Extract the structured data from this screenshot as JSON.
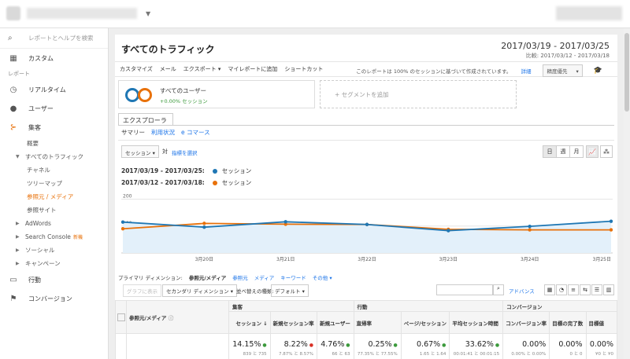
{
  "sidebar": {
    "search_placeholder": "レポートとヘルプを検索",
    "custom": "カスタム",
    "reports_label": "レポート",
    "realtime": "リアルタイム",
    "audience": "ユーザー",
    "acquisition": "集客",
    "overview": "概要",
    "all_traffic": "すべてのトラフィック",
    "channels": "チャネル",
    "treemap": "ツリーマップ",
    "source_medium": "参照元 / メディア",
    "referrals": "参照サイト",
    "adwords": "AdWords",
    "search_console": "Search Console",
    "new_badge": "新機",
    "social": "ソーシャル",
    "campaigns": "キャンペーン",
    "behavior": "行動",
    "conversions": "コンバージョン"
  },
  "header": {
    "title": "すべてのトラフィック",
    "date_range": "2017/03/19 - 2017/03/25",
    "compare_range": "比較: 2017/03/12 - 2017/03/18"
  },
  "toolbar": {
    "customize": "カスタマイズ",
    "email": "メール",
    "export": "エクスポート",
    "add_dashboard": "マイレポートに追加",
    "shortcut": "ショートカット",
    "sampling_note": "このレポートは 100% のセッションに基づいて作成されています。",
    "detail": "詳細",
    "priority": "精度優先"
  },
  "segment": {
    "name": "すべてのユーザー",
    "pct": "+0.00% セッション",
    "add": "+ セグメントを追加"
  },
  "tabs": {
    "explorer": "エクスプローラ",
    "summary": "サマリー",
    "usage": "利用状況",
    "ecommerce": "e コマース"
  },
  "chart_controls": {
    "metric": "セッション",
    "vs": "対",
    "select_metric": "指標を選択",
    "day": "日",
    "week": "週",
    "month": "月"
  },
  "legend": [
    {
      "range": "2017/03/19 - 2017/03/25:",
      "metric": "セッション",
      "color": "#1f77b4"
    },
    {
      "range": "2017/03/12 - 2017/03/18:",
      "metric": "セッション",
      "color": "#e8710a"
    }
  ],
  "chart_data": {
    "type": "line",
    "x": [
      "",
      "3月20日",
      "3月21日",
      "3月22日",
      "3月23日",
      "3月24日",
      "3月25日"
    ],
    "ytick_labels": [
      "200",
      "100"
    ],
    "ylim": [
      0,
      200
    ],
    "series": [
      {
        "name": "2017/03/19 - 2017/03/25",
        "color": "#1f77b4",
        "values": [
          115,
          96,
          116,
          106,
          83,
          99,
          118
        ]
      },
      {
        "name": "2017/03/12 - 2017/03/18",
        "color": "#e8710a",
        "values": [
          90,
          110,
          107,
          106,
          88,
          86,
          86
        ]
      }
    ],
    "grid": true
  },
  "dimensions": {
    "primary_label": "プライマリ ディメンション:",
    "source_medium": "参照元/メディア",
    "source": "参照元",
    "medium": "メディア",
    "keyword": "キーワード",
    "other": "その他"
  },
  "table_controls": {
    "plot_rows": "グラフに表示",
    "secondary": "セカンダリ ディメンション",
    "sort_label": "並べ替えの種類:",
    "sort_value": "デフォルト",
    "advanced": "アドバンス"
  },
  "table": {
    "dim_header": "参照元/メディア",
    "groups": [
      "集客",
      "行動",
      "コンバージョン"
    ],
    "headers": [
      "セッション",
      "新規セッション率",
      "新規ユーザー",
      "直帰率",
      "ページ/セッション",
      "平均セッション時間",
      "コンバージョン率",
      "目標の完了数",
      "目標値"
    ],
    "totals": [
      {
        "value": "14.15%",
        "dir": "up",
        "sub": "839 と 735"
      },
      {
        "value": "8.22%",
        "dir": "down",
        "sub": "7.87% と 8.57%"
      },
      {
        "value": "4.76%",
        "dir": "up",
        "sub": "66 と 63"
      },
      {
        "value": "0.25%",
        "dir": "up",
        "sub": "77.35% と 77.55%"
      },
      {
        "value": "0.67%",
        "dir": "up",
        "sub": "1.65 と 1.64"
      },
      {
        "value": "33.62%",
        "dir": "up",
        "sub": "00:01:41 と 00:01:15"
      },
      {
        "value": "0.00%",
        "dir": "",
        "sub": "0.00% と 0.00%"
      },
      {
        "value": "0.00%",
        "dir": "",
        "sub": "0 と 0"
      },
      {
        "value": "0.00%",
        "dir": "",
        "sub": "¥0 と ¥0"
      }
    ]
  }
}
